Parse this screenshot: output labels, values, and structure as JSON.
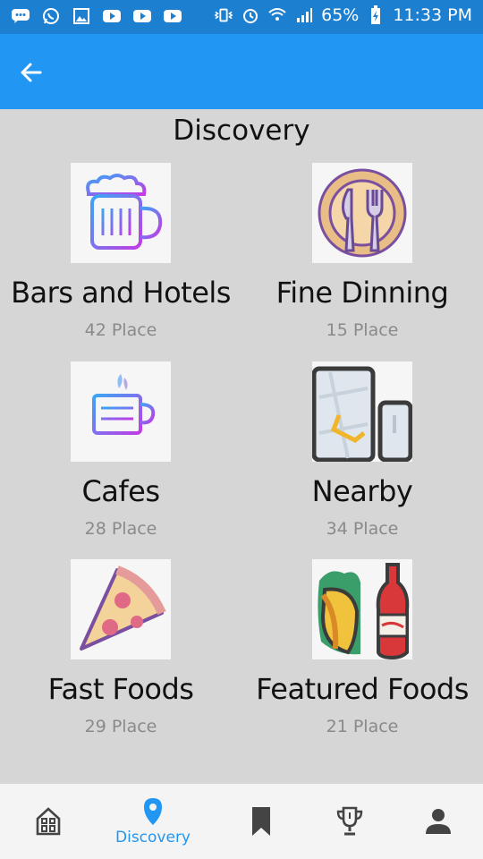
{
  "status_bar": {
    "battery": "65%",
    "time": "11:33 PM",
    "icons": [
      "message-icon",
      "whatsapp-icon",
      "gallery-icon",
      "youtube-icon",
      "youtube-icon",
      "youtube-icon",
      "vibrate-icon",
      "alarm-icon",
      "wifi-icon",
      "signal-icon",
      "battery-charging-icon"
    ]
  },
  "app_bar": {
    "back_icon": "arrow-left-icon",
    "color": "#2196f3"
  },
  "page": {
    "title": "Discovery"
  },
  "categories": [
    {
      "name": "Bars and Hotels",
      "count": "42 Place",
      "icon": "beer-mug-icon"
    },
    {
      "name": "Fine Dinning",
      "count": "15 Place",
      "icon": "plate-cutlery-icon"
    },
    {
      "name": "Cafes",
      "count": "28 Place",
      "icon": "coffee-cup-icon"
    },
    {
      "name": "Nearby",
      "count": "34 Place",
      "icon": "map-phone-icon"
    },
    {
      "name": "Fast Foods",
      "count": "29 Place",
      "icon": "pizza-slice-icon"
    },
    {
      "name": "Featured Foods",
      "count": "21 Place",
      "icon": "taco-cola-icon"
    }
  ],
  "bottom_nav": {
    "active_label": "Discovery",
    "active_color": "#2196f3",
    "items": [
      "home-icon",
      "location-pin-icon",
      "bookmark-icon",
      "trophy-icon",
      "person-icon"
    ]
  }
}
